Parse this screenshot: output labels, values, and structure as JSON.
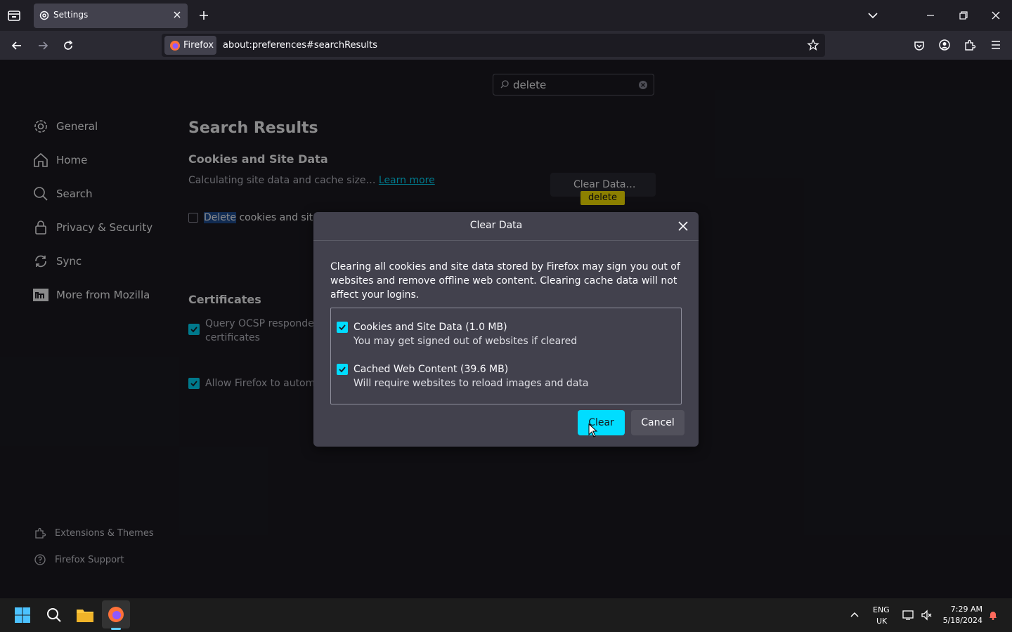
{
  "browser": {
    "tab_title": "Settings",
    "identity_label": "Firefox",
    "url": "about:preferences#searchResults"
  },
  "search": {
    "value": "delete"
  },
  "sidebar": {
    "items": [
      {
        "label": "General",
        "icon": "gear-icon"
      },
      {
        "label": "Home",
        "icon": "home-icon"
      },
      {
        "label": "Search",
        "icon": "search-icon"
      },
      {
        "label": "Privacy & Security",
        "icon": "lock-icon"
      },
      {
        "label": "Sync",
        "icon": "sync-icon"
      },
      {
        "label": "More from Mozilla",
        "icon": "mozilla-icon"
      }
    ],
    "footer": [
      {
        "label": "Extensions & Themes",
        "icon": "puzzle-icon"
      },
      {
        "label": "Firefox Support",
        "icon": "help-icon"
      }
    ]
  },
  "main": {
    "title": "Search Results",
    "cookies_heading": "Cookies and Site Data",
    "cookies_desc": "Calculating site data and cache size…",
    "learn_more": "Learn more",
    "clear_data_button": "Clear Data…",
    "highlight_badge": "delete",
    "delete_row_highlight": "Delete",
    "delete_row_rest": "cookies and site",
    "cert_heading": "Certificates",
    "ocsp_line1": "Query OCSP responder",
    "ocsp_line2": "certificates",
    "auto_row": "Allow Firefox to autom"
  },
  "dialog": {
    "title": "Clear Data",
    "text": "Clearing all cookies and site data stored by Firefox may sign you out of websites and remove offline web content. Clearing cache data will not affect your logins.",
    "options": [
      {
        "title": "Cookies and Site Data (1.0 MB)",
        "subtitle": "You may get signed out of websites if cleared",
        "checked": true
      },
      {
        "title": "Cached Web Content (39.6 MB)",
        "subtitle": "Will require websites to reload images and data",
        "checked": true
      }
    ],
    "clear_button": "Clear",
    "cancel_button": "Cancel"
  },
  "taskbar": {
    "lang_line1": "ENG",
    "lang_line2": "UK",
    "time": "7:29 AM",
    "date": "5/18/2024"
  },
  "colors": {
    "accent": "#00ddff",
    "dialog_bg": "#42414d",
    "page_bg": "#1c1b22",
    "highlight": "#ffe900"
  }
}
